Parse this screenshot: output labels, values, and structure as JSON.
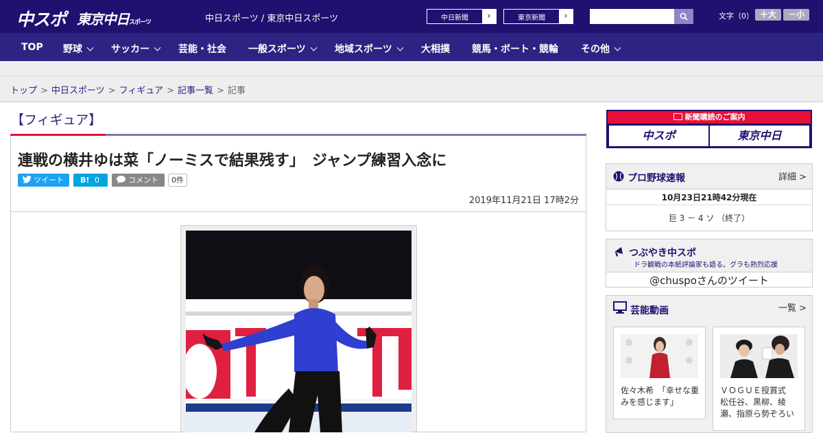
{
  "header": {
    "logo_chuspo": "中スポ",
    "logo_tokyo": "東京中日",
    "logo_tokyo_small": "スポーツ",
    "site_names": "中日スポーツ / 東京中日スポーツ",
    "btn_chunichi": "中日新聞",
    "btn_tokyo": "東京新聞",
    "btn_arrow": "›",
    "search_placeholder": "",
    "font_size_label": "文字（0）",
    "font_larger": "＋大",
    "font_smaller": "－小"
  },
  "nav": {
    "items": [
      "TOP",
      "野球",
      "サッカー",
      "芸能・社会",
      "一般スポーツ",
      "地域スポーツ",
      "大相撲",
      "競馬・ボート・競輪",
      "その他"
    ]
  },
  "breadcrumb": {
    "items": [
      "トップ",
      "中日スポーツ",
      "フィギュア",
      "記事一覧"
    ],
    "current": "記事",
    "separator": ">"
  },
  "article": {
    "category": "【フィギュア】",
    "headline": "連戦の横井ゆは菜「ノーミスで結果残す」　ジャンプ練習入念に",
    "tweet_label": "ツイート",
    "hatena_label": "B!",
    "hatena_count": "0",
    "comment_label": "コメント",
    "comment_count": "0件",
    "date": "2019年11月21日 17時2分"
  },
  "sidebar": {
    "subscribe": {
      "title": "新聞購読のご案内",
      "left": "中スポ",
      "right": "東京中日"
    },
    "baseball": {
      "title": "プロ野球速報",
      "more": "詳細 >",
      "time": "10月23日21時42分現在",
      "score": "巨 3 － 4 ソ （終了）"
    },
    "tsubuyaki": {
      "title": "つぶやき中スポ",
      "subtitle": "ドラ観戦の本紙評論家も語る。グラも熱烈応援",
      "account": "@chuspoさんのツイート"
    },
    "video": {
      "title": "芸能動画",
      "more": "一覧 >",
      "items": [
        {
          "caption": "佐々木希　「幸せな重みを感じます」"
        },
        {
          "caption": "ＶＯＧＵＥ授賞式　松任谷、黒柳、綾瀬、指原ら勢ぞろい"
        }
      ]
    }
  },
  "colors": {
    "brand_navy": "#1e1170",
    "nav_bg": "#2d2382",
    "accent_red": "#e8103a",
    "twitter_blue": "#1da1f2",
    "hatena_blue": "#00a4de"
  }
}
